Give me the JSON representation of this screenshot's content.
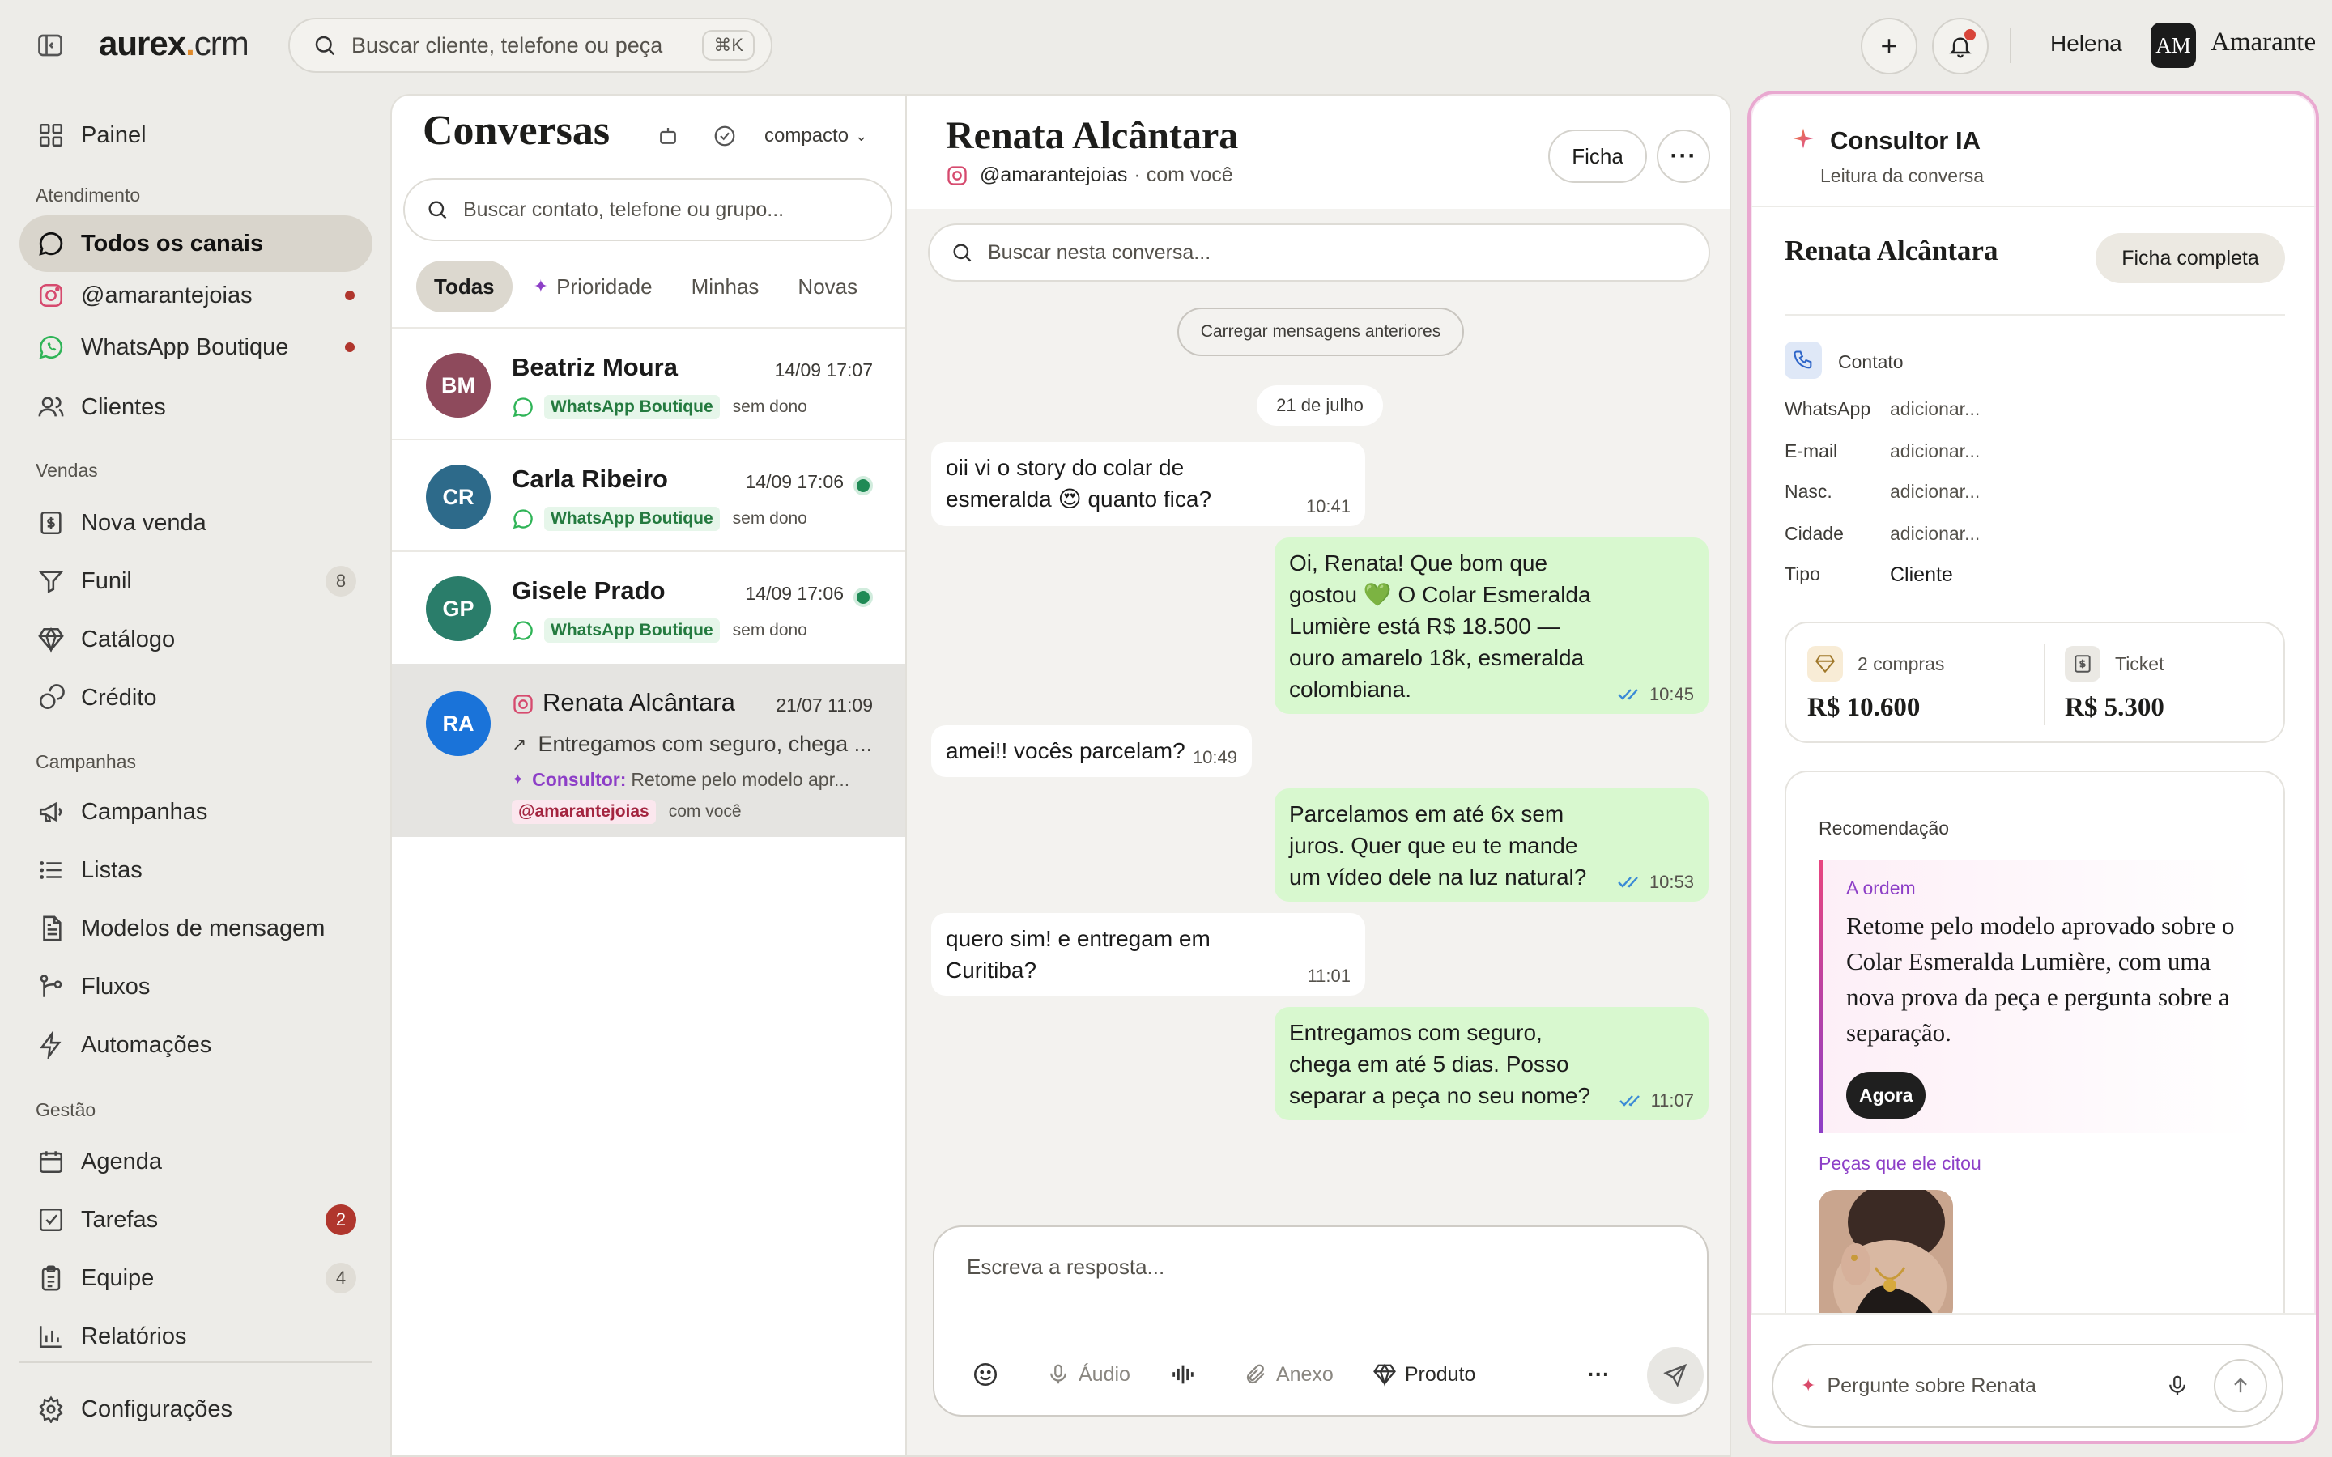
{
  "brand": {
    "name_main": "aurex",
    "name_dot": ".",
    "name_suffix": "crm",
    "accent": "#e08a2a"
  },
  "topbar": {
    "search_placeholder": "Buscar cliente, telefone ou peça",
    "shortcut": "⌘K",
    "user_name": "Helena",
    "org_initials": "AM",
    "org_name": "Amarante"
  },
  "sidebar": {
    "painel": "Painel",
    "sections": {
      "atendimento": "Atendimento",
      "vendas": "Vendas",
      "campanhas": "Campanhas",
      "gestao": "Gestão"
    },
    "items": {
      "todos_canais": "Todos os canais",
      "instagram": "@amarantejoias",
      "whatsapp": "WhatsApp Boutique",
      "clientes": "Clientes",
      "nova_venda": "Nova venda",
      "funil": "Funil",
      "funil_badge": "8",
      "catalogo": "Catálogo",
      "credito": "Crédito",
      "campanhas": "Campanhas",
      "listas": "Listas",
      "modelos": "Modelos de mensagem",
      "fluxos": "Fluxos",
      "automacoes": "Automações",
      "agenda": "Agenda",
      "tarefas": "Tarefas",
      "tarefas_badge": "2",
      "equipe": "Equipe",
      "equipe_badge": "4",
      "relatorios": "Relatórios",
      "configuracoes": "Configurações"
    }
  },
  "conversations": {
    "title": "Conversas",
    "view_mode": "compacto",
    "search_placeholder": "Buscar contato, telefone ou grupo...",
    "filters": [
      "Todas",
      "Prioridade",
      "Minhas",
      "Novas"
    ],
    "items": [
      {
        "initials": "BM",
        "name": "Beatriz Moura",
        "time": "14/09 17:07",
        "channel": "WhatsApp Boutique",
        "owner": "sem dono",
        "color": "#8e4a5c"
      },
      {
        "initials": "CR",
        "name": "Carla Ribeiro",
        "time": "14/09 17:06",
        "channel": "WhatsApp Boutique",
        "owner": "sem dono",
        "color": "#2d6a8a"
      },
      {
        "initials": "GP",
        "name": "Gisele Prado",
        "time": "14/09 17:06",
        "channel": "WhatsApp Boutique",
        "owner": "sem dono",
        "color": "#2a7d6a"
      },
      {
        "initials": "RA",
        "name": "Renata Alcântara",
        "time": "21/07 11:09",
        "preview": "Entregamos com seguro, chega ...",
        "consultor_label": "Consultor:",
        "consultor_text": "Retome pelo modelo apr...",
        "channel": "@amarantejoias",
        "owner": "com você",
        "color": "#1a73d9"
      }
    ]
  },
  "chat": {
    "name": "Renata Alcântara",
    "handle": "@amarantejoias",
    "owner": "· com você",
    "ficha_label": "Ficha",
    "search_placeholder": "Buscar nesta conversa...",
    "load_older": "Carregar mensagens anteriores",
    "date": "21 de julho",
    "messages": [
      {
        "dir": "in",
        "line1": "oii vi o story do colar de",
        "line2": "esmeralda 😍  quanto fica?",
        "time": "10:41"
      },
      {
        "dir": "out",
        "line1": "Oi, Renata! Que bom que",
        "line2": "gostou 💚  O Colar Esmeralda",
        "line3": "Lumière está R$ 18.500 —",
        "line4": "ouro amarelo 18k, esmeralda",
        "line5": "colombiana.",
        "time": "10:45"
      },
      {
        "dir": "in",
        "line1": "amei!! vocês parcelam?",
        "time": "10:49"
      },
      {
        "dir": "out",
        "line1": "Parcelamos em até 6x sem",
        "line2": "juros. Quer que eu te mande",
        "line3": "um vídeo dele na luz natural?",
        "time": "10:53"
      },
      {
        "dir": "in",
        "line1": "quero sim! e entregam em",
        "line2": "Curitiba?",
        "time": "11:01"
      },
      {
        "dir": "out",
        "line1": "Entregamos com seguro,",
        "line2": "chega em até 5 dias. Posso",
        "line3": "separar a peça no seu nome?",
        "time": "11:07"
      }
    ],
    "composer": {
      "placeholder": "Escreva a resposta...",
      "audio": "Áudio",
      "anexo": "Anexo",
      "produto": "Produto"
    }
  },
  "ai": {
    "title": "Consultor IA",
    "subtitle": "Leitura da conversa",
    "client_name": "Renata Alcântara",
    "full_profile": "Ficha completa",
    "contact_label": "Contato",
    "fields": [
      {
        "k": "WhatsApp",
        "v": "adicionar..."
      },
      {
        "k": "E-mail",
        "v": "adicionar..."
      },
      {
        "k": "Nasc.",
        "v": "adicionar..."
      },
      {
        "k": "Cidade",
        "v": "adicionar..."
      },
      {
        "k": "Tipo",
        "v": "Cliente"
      }
    ],
    "stats": {
      "purchases_label": "2 compras",
      "purchases_value": "R$ 10.600",
      "ticket_label": "Ticket",
      "ticket_value": "R$ 5.300"
    },
    "recommendation": {
      "title": "Recomendação",
      "label": "A ordem",
      "body": "Retome pelo modelo aprovado sobre o Colar Esmeralda Lumière, com uma nova prova da peça e pergunta sobre a separação.",
      "when": "Agora"
    },
    "pieces_title": "Peças que ele citou",
    "ask_placeholder": "Pergunte sobre Renata"
  }
}
